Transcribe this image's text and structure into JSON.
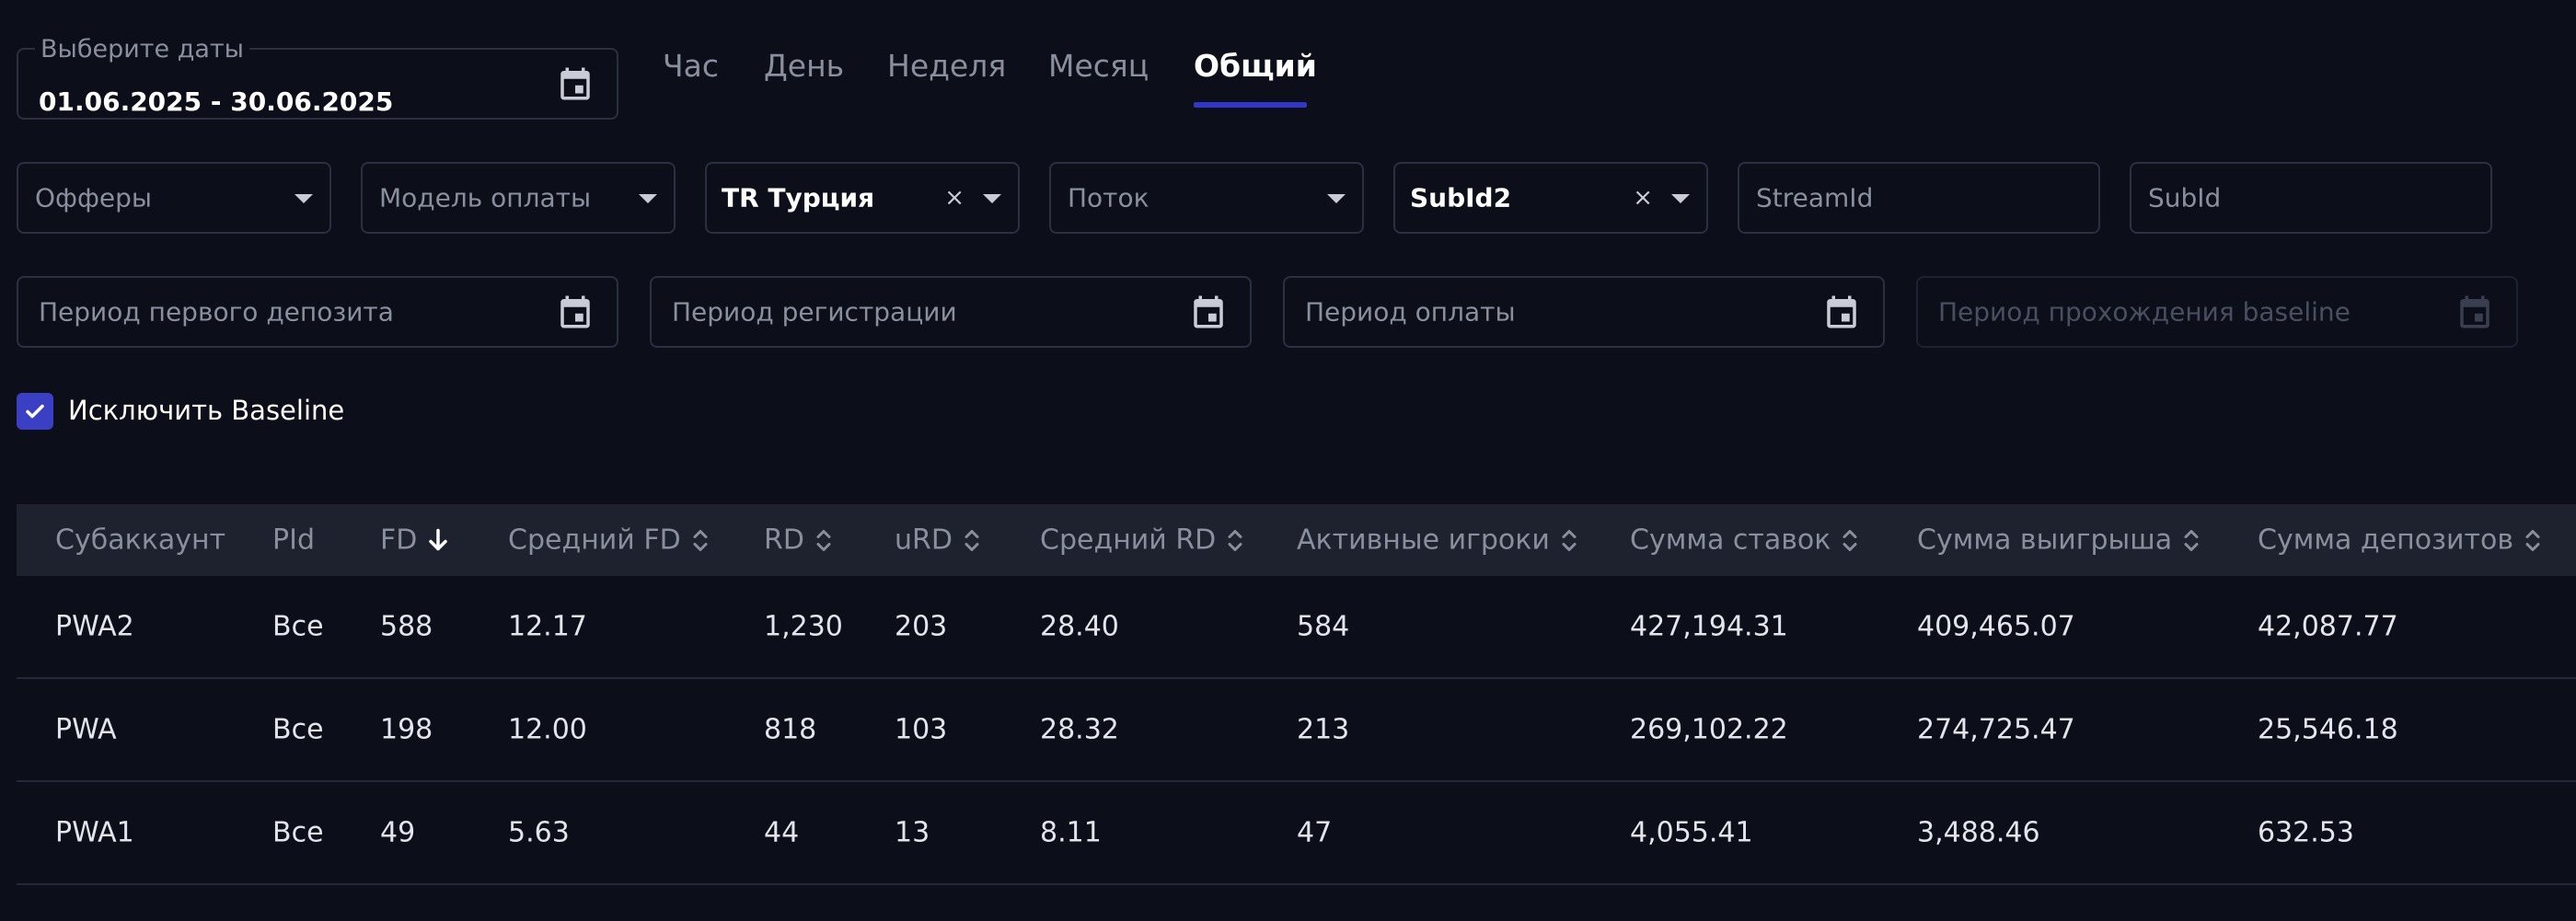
{
  "date_picker": {
    "legend": "Выберите даты",
    "value": "01.06.2025 - 30.06.2025"
  },
  "tabs": [
    {
      "label": "Час"
    },
    {
      "label": "День"
    },
    {
      "label": "Неделя"
    },
    {
      "label": "Месяц"
    },
    {
      "label": "Общий",
      "active": true
    }
  ],
  "filters_row1": {
    "offers": {
      "placeholder": "Офферы"
    },
    "payment_model": {
      "placeholder": "Модель оплаты"
    },
    "country": {
      "value": "TR Турция",
      "clear": "×"
    },
    "flow": {
      "placeholder": "Поток"
    },
    "subid_select": {
      "value": "SubId2",
      "clear": "×"
    },
    "stream_id": {
      "placeholder": "StreamId"
    },
    "sub_id": {
      "placeholder": "SubId"
    }
  },
  "filters_row2": {
    "first_deposit_period": {
      "placeholder": "Период первого депозита"
    },
    "registration_period": {
      "placeholder": "Период регистрации"
    },
    "payment_period": {
      "placeholder": "Период оплаты"
    },
    "baseline_period": {
      "placeholder": "Период прохождения baseline",
      "disabled": true
    }
  },
  "exclude_baseline": {
    "label": "Исключить Baseline",
    "checked": true
  },
  "table": {
    "columns": [
      {
        "label": "Субаккаунт"
      },
      {
        "label": "PId"
      },
      {
        "label": "FD",
        "sort": "desc"
      },
      {
        "label": "Средний FD",
        "sort": "both"
      },
      {
        "label": "RD",
        "sort": "both"
      },
      {
        "label": "uRD",
        "sort": "both"
      },
      {
        "label": "Средний RD",
        "sort": "both"
      },
      {
        "label": "Активные игроки",
        "sort": "both"
      },
      {
        "label": "Сумма ставок",
        "sort": "both"
      },
      {
        "label": "Сумма выигрыша",
        "sort": "both"
      },
      {
        "label": "Сумма депозитов",
        "sort": "both"
      }
    ],
    "rows": [
      [
        "PWA2",
        "Все",
        "588",
        "12.17",
        "1,230",
        "203",
        "28.40",
        "584",
        "427,194.31",
        "409,465.07",
        "42,087.77"
      ],
      [
        "PWA",
        "Все",
        "198",
        "12.00",
        "818",
        "103",
        "28.32",
        "213",
        "269,102.22",
        "274,725.47",
        "25,546.18"
      ],
      [
        "PWA1",
        "Все",
        "49",
        "5.63",
        "44",
        "13",
        "8.11",
        "47",
        "4,055.41",
        "3,488.46",
        "632.53"
      ]
    ]
  },
  "colors": {
    "background": "#0c0e19",
    "accent": "#3136c7",
    "header_bg": "#1e222f"
  }
}
